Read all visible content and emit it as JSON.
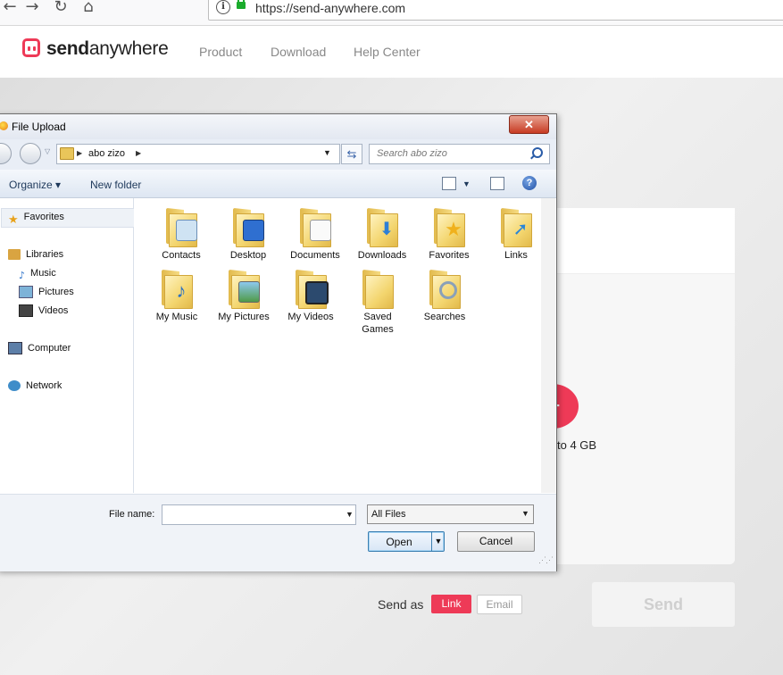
{
  "browser": {
    "url": "https://send-anywhere.com",
    "icons": [
      "back-icon",
      "forward-icon",
      "reload-icon",
      "home-icon",
      "info-icon",
      "lock-icon"
    ]
  },
  "site": {
    "logo_part1": "send",
    "logo_part2": "anywhere",
    "nav": [
      "Product",
      "Download",
      "Help Center"
    ],
    "upload_limit_text": "to 4 GB",
    "add_glyph": "+",
    "send_as_label": "Send as",
    "link_label": "Link",
    "email_label": "Email",
    "send_label": "Send",
    "accent_color": "#ee3a57"
  },
  "dialog": {
    "title": "File Upload",
    "close_glyph": "✕",
    "breadcrumb": "abo zizo",
    "search_placeholder": "Search abo zizo",
    "organize_label": "Organize",
    "new_folder_label": "New folder",
    "help_glyph": "?",
    "nav": {
      "favorites": "Favorites",
      "libraries": "Libraries",
      "music": "Music",
      "pictures": "Pictures",
      "videos": "Videos",
      "computer": "Computer",
      "network": "Network"
    },
    "files": [
      {
        "label": "Contacts"
      },
      {
        "label": "Desktop"
      },
      {
        "label": "Documents"
      },
      {
        "label": "Downloads"
      },
      {
        "label": "Favorites"
      },
      {
        "label": "Links"
      },
      {
        "label": "My Music"
      },
      {
        "label": "My Pictures"
      },
      {
        "label": "My Videos"
      },
      {
        "label": "Saved Games"
      },
      {
        "label": "Searches"
      }
    ],
    "file_name_label": "File name:",
    "file_name_value": "",
    "file_type_value": "All Files",
    "open_label": "Open",
    "cancel_label": "Cancel"
  }
}
